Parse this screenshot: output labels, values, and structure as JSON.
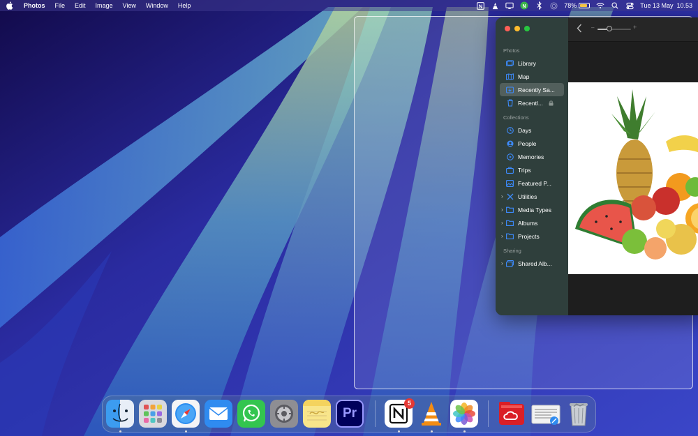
{
  "menubar": {
    "app_name": "Photos",
    "menus": [
      "File",
      "Edit",
      "Image",
      "View",
      "Window",
      "Help"
    ],
    "battery_percent": "78%",
    "battery_level": 0.78,
    "clock": "Tue 13 May  10.53"
  },
  "sidebar": {
    "photos_section": "Photos",
    "photos_items": [
      {
        "label": "Library",
        "icon": "library-icon"
      },
      {
        "label": "Map",
        "icon": "map-icon"
      },
      {
        "label": "Recently Sa...",
        "icon": "recently-saved-icon",
        "selected": true
      },
      {
        "label": "Recentl...",
        "icon": "trash-icon",
        "locked": true
      }
    ],
    "collections_section": "Collections",
    "collections_items": [
      {
        "label": "Days",
        "icon": "clock-icon"
      },
      {
        "label": "People",
        "icon": "person-icon"
      },
      {
        "label": "Memories",
        "icon": "memories-icon"
      },
      {
        "label": "Trips",
        "icon": "suitcase-icon"
      },
      {
        "label": "Featured P...",
        "icon": "photo-icon"
      },
      {
        "label": "Utilities",
        "icon": "tools-icon",
        "expandable": true
      },
      {
        "label": "Media Types",
        "icon": "folder-icon",
        "expandable": true
      },
      {
        "label": "Albums",
        "icon": "folder-icon",
        "expandable": true
      },
      {
        "label": "Projects",
        "icon": "folder-icon",
        "expandable": true
      }
    ],
    "sharing_section": "Sharing",
    "sharing_items": [
      {
        "label": "Shared Alb...",
        "icon": "shared-album-icon",
        "expandable": true
      }
    ]
  },
  "toolbar": {
    "zoom_minus": "–",
    "zoom_plus": "+",
    "zoom_level": 0.35
  },
  "dock": {
    "apps": [
      "Finder",
      "Launchpad",
      "Safari",
      "Mail",
      "WhatsApp",
      "System Settings",
      "Notes",
      "Premiere Pro",
      "Notion",
      "VLC",
      "Photos",
      "Creative Cloud",
      "Preview",
      "Trash"
    ],
    "premiere_label": "Pr",
    "notion_badge": "5"
  },
  "colors": {
    "accent": "#3d8bfd",
    "sidebar_bg": "#2f3f3c",
    "menubar_bg": "#3c378c"
  }
}
